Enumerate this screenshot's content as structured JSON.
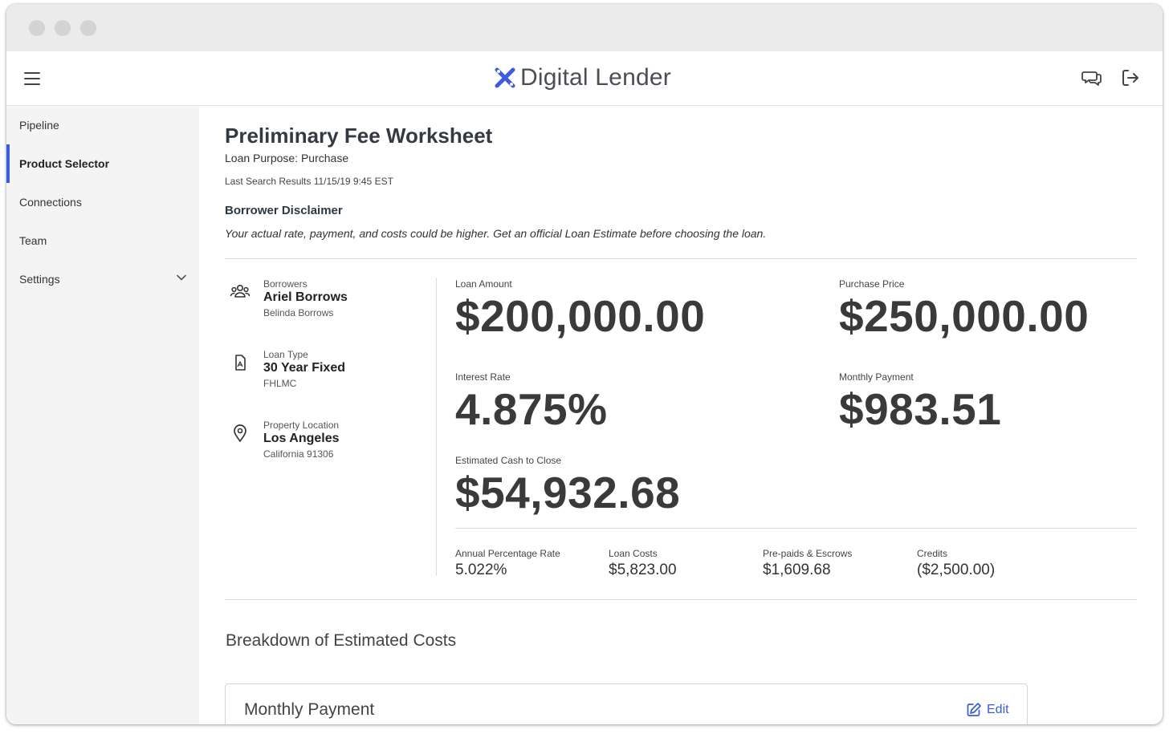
{
  "app": {
    "name": "Digital Lender",
    "brand_color": "#3d5be0"
  },
  "sidebar": {
    "items": [
      {
        "label": "Pipeline",
        "active": false
      },
      {
        "label": "Product Selector",
        "active": true
      },
      {
        "label": "Connections",
        "active": false
      },
      {
        "label": "Team",
        "active": false
      },
      {
        "label": "Settings",
        "active": false,
        "has_dropdown": true
      }
    ]
  },
  "header": {
    "icons": [
      "menu-icon",
      "chat-icon",
      "logout-icon"
    ]
  },
  "page": {
    "title": "Preliminary Fee Worksheet",
    "loan_purpose": "Loan Purpose: Purchase",
    "last_search": "Last Search Results 11/15/19 9:45 EST",
    "disclaimer_heading": "Borrower Disclaimer",
    "disclaimer_text": "Your actual rate, payment, and costs could be higher. Get an official Loan Estimate before choosing the loan."
  },
  "info": {
    "borrowers": {
      "caption": "Borrowers",
      "value": "Ariel Borrows",
      "sub": "Belinda Borrows",
      "icon": "people-icon"
    },
    "loan_type": {
      "caption": "Loan Type",
      "value": "30 Year Fixed",
      "sub": "FHLMC",
      "icon": "document-icon"
    },
    "location": {
      "caption": "Property Location",
      "value": "Los Angeles",
      "sub": "California 91306",
      "icon": "location-pin-icon"
    }
  },
  "figures": {
    "loan_amount": {
      "caption": "Loan Amount",
      "value": "$200,000.00"
    },
    "purchase_price": {
      "caption": "Purchase Price",
      "value": "$250,000.00"
    },
    "interest_rate": {
      "caption": "Interest Rate",
      "value": "4.875%"
    },
    "monthly_payment": {
      "caption": "Monthly Payment",
      "value": "$983.51"
    },
    "cash_to_close": {
      "caption": "Estimated Cash to Close",
      "value": "$54,932.68"
    }
  },
  "summary": [
    {
      "caption": "Annual Percentage Rate",
      "value": "5.022%"
    },
    {
      "caption": "Loan Costs",
      "value": "$5,823.00"
    },
    {
      "caption": "Pre-paids & Escrows",
      "value": "$1,609.68"
    },
    {
      "caption": "Credits",
      "value": "($2,500.00)"
    }
  ],
  "breakdown": {
    "heading": "Breakdown of Estimated Costs",
    "card_title": "Monthly Payment",
    "edit_label": "Edit"
  }
}
